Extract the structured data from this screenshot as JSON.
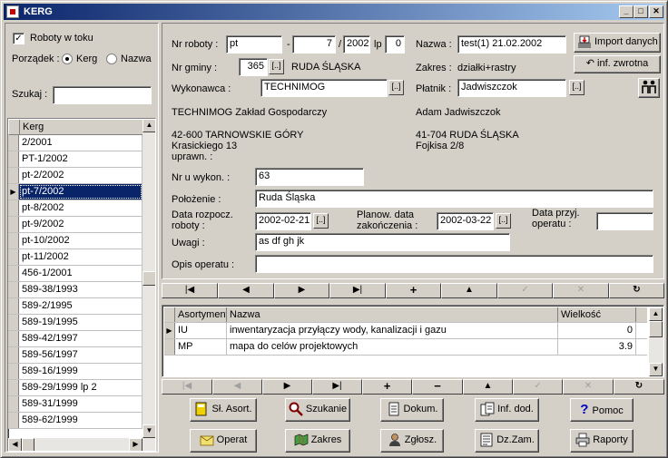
{
  "window": {
    "title": "KERG"
  },
  "left": {
    "checkbox_label": "Roboty w toku",
    "order_label": "Porządek :",
    "order_options": [
      "Kerg",
      "Nazwa"
    ],
    "search_label": "Szukaj :",
    "search_value": "",
    "list_header": "Kerg",
    "list_items": [
      "2/2001",
      "PT-1/2002",
      "pt-2/2002",
      "pt-7/2002",
      "pt-8/2002",
      "pt-9/2002",
      "pt-10/2002",
      "pt-11/2002",
      "456-1/2001",
      "589-38/1993",
      "589-2/1995",
      "589-19/1995",
      "589-42/1997",
      "589-56/1997",
      "589-16/1999",
      "589-29/1999 lp 2",
      "589-31/1999",
      "589-62/1999"
    ],
    "selected": "pt-7/2002"
  },
  "form": {
    "nr_roboty_label": "Nr roboty :",
    "nr_roboty_prefix": "pt",
    "nr_sep1": "-",
    "nr_number": "7",
    "nr_sep2": "/",
    "nr_year": "2002",
    "lp_label": "lp",
    "lp_value": "0",
    "nazwa_label": "Nazwa :",
    "nazwa_value": "test(1) 21.02.2002",
    "import_button": "Import danych",
    "inf_zwrotna_button": "inf. zwrotna",
    "nr_gminy_label": "Nr gminy :",
    "nr_gminy_value": "365",
    "gmina_name": "RUDA ŚLĄSKA",
    "zakres_label": "Zakres :",
    "zakres_value": "działki+rastry",
    "wykonawca_label": "Wykonawca :",
    "wykonawca_value": "TECHNIMOG",
    "platnik_label": "Płatnik :",
    "platnik_value": "Jadwiszczok",
    "dots": "[..]",
    "wyk_name": "TECHNIMOG  Zakład Gospodarczy",
    "wyk_addr1": "42-600 TARNOWSKIE GÓRY",
    "wyk_addr2": "Krasickiego 13",
    "wyk_addr3": "uprawn. :",
    "plat_name": "Adam Jadwiszczok",
    "plat_addr1": "41-704 RUDA ŚLĄSKA",
    "plat_addr2": "Fojkisa 2/8",
    "nr_u_wykon_label": "Nr u wykon. :",
    "nr_u_wykon_value": "63",
    "polozenie_label": "Położenie :",
    "polozenie_value": "Ruda Śląska",
    "data_rozp_label1": "Data rozpocz.",
    "data_rozp_label2": "roboty :",
    "data_rozp_value": "2002-02-21",
    "planow_label1": "Planow. data",
    "planow_label2": "zakończenia :",
    "planow_value": "2002-03-22",
    "data_przyj_label1": "Data przyj.",
    "data_przyj_label2": "operatu :",
    "data_przyj_value": "",
    "uwagi_label": "Uwagi :",
    "uwagi_value": "as df gh jk",
    "opis_label": "Opis operatu :",
    "opis_value": ""
  },
  "nav_icons": [
    "|◀",
    "◀",
    "▶",
    "▶|",
    "+",
    "▲",
    "✓",
    "✕",
    "↻"
  ],
  "nav2_icons": [
    "|◀",
    "◀",
    "▶",
    "▶|",
    "+",
    "−",
    "▲",
    "✓",
    "✕",
    "↻"
  ],
  "table": {
    "headers": [
      "Asortyment",
      "Nazwa",
      "Wielkość"
    ],
    "rows": [
      {
        "code": "IU",
        "name": "inwentaryzacja przyłączy wody, kanalizacji i gazu",
        "qty": "0"
      },
      {
        "code": "MP",
        "name": "mapa do celów projektowych",
        "qty": "3.9"
      }
    ]
  },
  "buttons_row1": [
    "Sł. Asort.",
    "Szukanie",
    "Dokum.",
    "Inf. dod.",
    "Pomoc"
  ],
  "buttons_row2": [
    "Operat",
    "Zakres",
    "Zgłosz.",
    "Dz.Zam.",
    "Raporty"
  ]
}
